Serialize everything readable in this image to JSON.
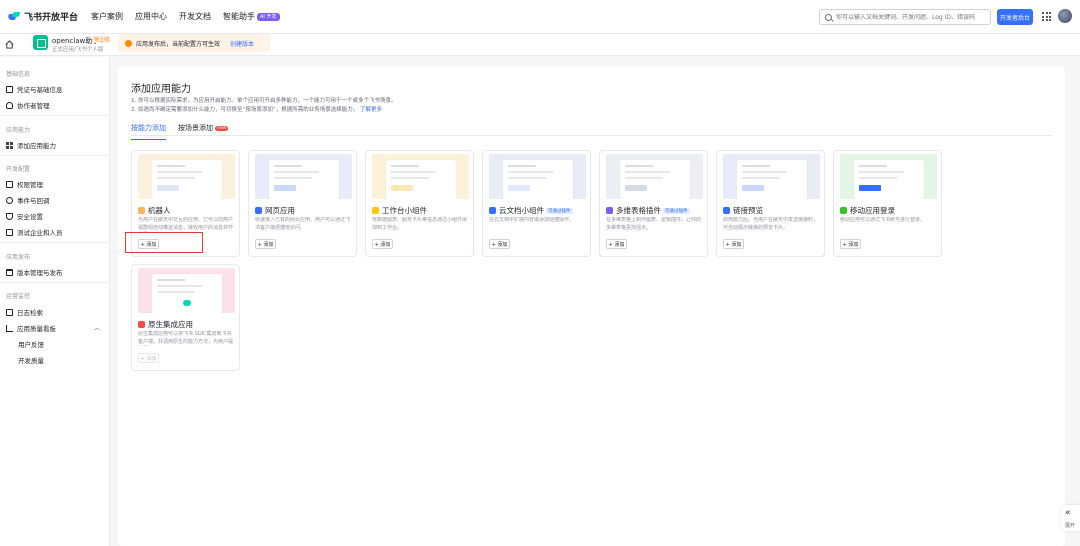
{
  "topbar": {
    "logo_text": "飞书开放平台",
    "nav": [
      "客户案例",
      "应用中心",
      "开发文档",
      "智能助手"
    ],
    "ai_badge": "AI 开发",
    "search_placeholder": "你可以输入文档关键词、开发问题、Log ID、错误码",
    "dev_console": "开发者后台"
  },
  "appbar": {
    "app_name": "openclaw助手",
    "app_status": "待上线",
    "app_desc": "正式应用/飞书个人版",
    "notice_text": "应用发布后，当前配置方可生效",
    "notice_link": "创建版本"
  },
  "sidebar": {
    "sections": {
      "basic": "基础信息",
      "ability": "应用能力",
      "dev": "开发配置",
      "publish": "应用发布",
      "monitor": "运营监控"
    },
    "items": {
      "credentials": "凭证与基础信息",
      "collaborators": "协作者管理",
      "add_ability": "添加应用能力",
      "permissions": "权限管理",
      "events": "事件与回调",
      "security": "安全设置",
      "test_enterprise": "测试企业和人员",
      "version": "版本管理与发布",
      "logs": "日志检索",
      "dashboard": "应用质量看板",
      "user_feedback": "用户反馈",
      "dev_quality": "开发质量"
    }
  },
  "main": {
    "title": "添加应用能力",
    "desc1": "1. 你可以根据实际需求，为应用开启能力。单个应用可开启多种能力，一个能力可用于一个或多个飞书场景。",
    "desc2": "2. 如遇尚不确定需要添加什么能力，可切换至“按场景添加”，根据所需的业务场景选择能力。",
    "desc2_link": "了解更多",
    "tab_ability": "按能力添加",
    "tab_scene": "按场景添加",
    "tab_new": "new",
    "add_label": "+ 添加",
    "cards": [
      {
        "title": "机器人",
        "tag": "",
        "desc": "与用户在聊天中交互的应用。它可以向用户或群组自动推送消息，接收用户的消息并作出回应。"
      },
      {
        "title": "网页应用",
        "tag": "",
        "desc": "快速接入已有的网页应用，用户可以通过飞书客户端便捷地访问。"
      },
      {
        "title": "工作台小组件",
        "tag": "",
        "desc": "将数据图表、服务卡片等信息通过小组件添加到工作台。"
      },
      {
        "title": "云文档小组件",
        "tag": "可通过插件",
        "desc": "在云文档中扩展内容或添加便捷操作。"
      },
      {
        "title": "多维表格插件",
        "tag": "可通过插件",
        "desc": "在多维表格上制作图表、逻辑插件，让你的多维表格更加强大。"
      },
      {
        "title": "链接预览",
        "tag": "",
        "desc": "启用能力后，当用户在聊天中发送链接时，可自动展示链接的预览卡片。"
      },
      {
        "title": "移动应用登录",
        "tag": "",
        "desc": "移动应用可以通过飞书账号进行登录。"
      },
      {
        "title": "原生集成应用",
        "tag": "",
        "desc": "原生集成应用可以将飞书 SDK 集成到飞书客户端，并调用原生的能力方法，为用户提供服务。"
      }
    ]
  },
  "collapse_label": "展开",
  "colors": {
    "accent": "#3370ff",
    "highlight": "#e23b36",
    "warning": "#ff8800"
  }
}
